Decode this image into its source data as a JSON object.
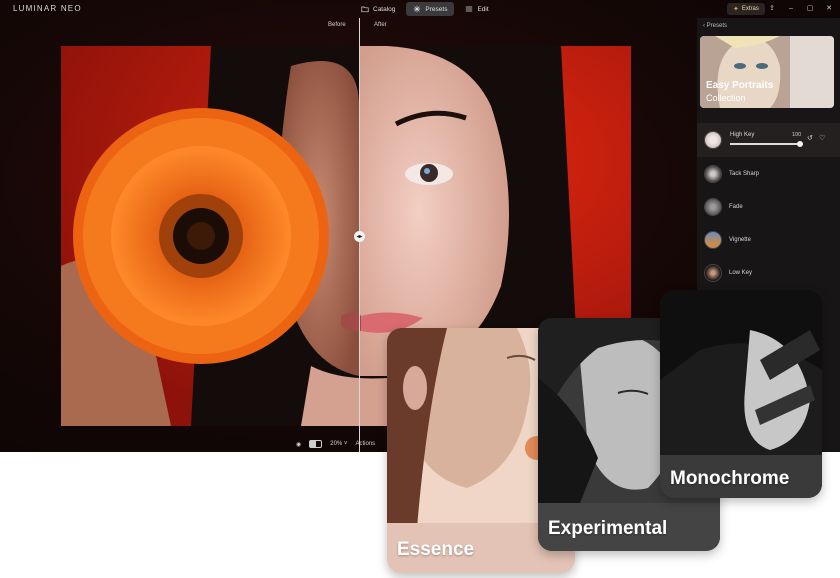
{
  "app": {
    "logo": "LUMINAR NEO"
  },
  "nav": {
    "tabs": [
      {
        "label": "Catalog",
        "icon": "folder-icon",
        "active": false
      },
      {
        "label": "Presets",
        "icon": "presets-icon",
        "active": true
      },
      {
        "label": "Edit",
        "icon": "sliders-icon",
        "active": false
      }
    ],
    "extras_label": "Extras"
  },
  "compare": {
    "before_label": "Before",
    "after_label": "After"
  },
  "bottom_bar": {
    "zoom": "20%",
    "actions_label": "Actions"
  },
  "panel": {
    "back_label": "Presets",
    "collection": {
      "title": "Easy Portraits",
      "subtitle": "Collection"
    },
    "presets": [
      {
        "label": "High Key",
        "active": true,
        "amount": "100",
        "level": 1.0
      },
      {
        "label": "Tack Sharp",
        "active": false
      },
      {
        "label": "Fade",
        "active": false
      },
      {
        "label": "Vignette",
        "active": false
      },
      {
        "label": "Low Key",
        "active": false
      }
    ]
  },
  "cards": [
    {
      "label": "Essence"
    },
    {
      "label": "Experimental"
    },
    {
      "label": "Monochrome"
    }
  ],
  "colors": {
    "accent": "#f39a3a",
    "background_red": "#c81f10",
    "flower": "#f06a12"
  }
}
